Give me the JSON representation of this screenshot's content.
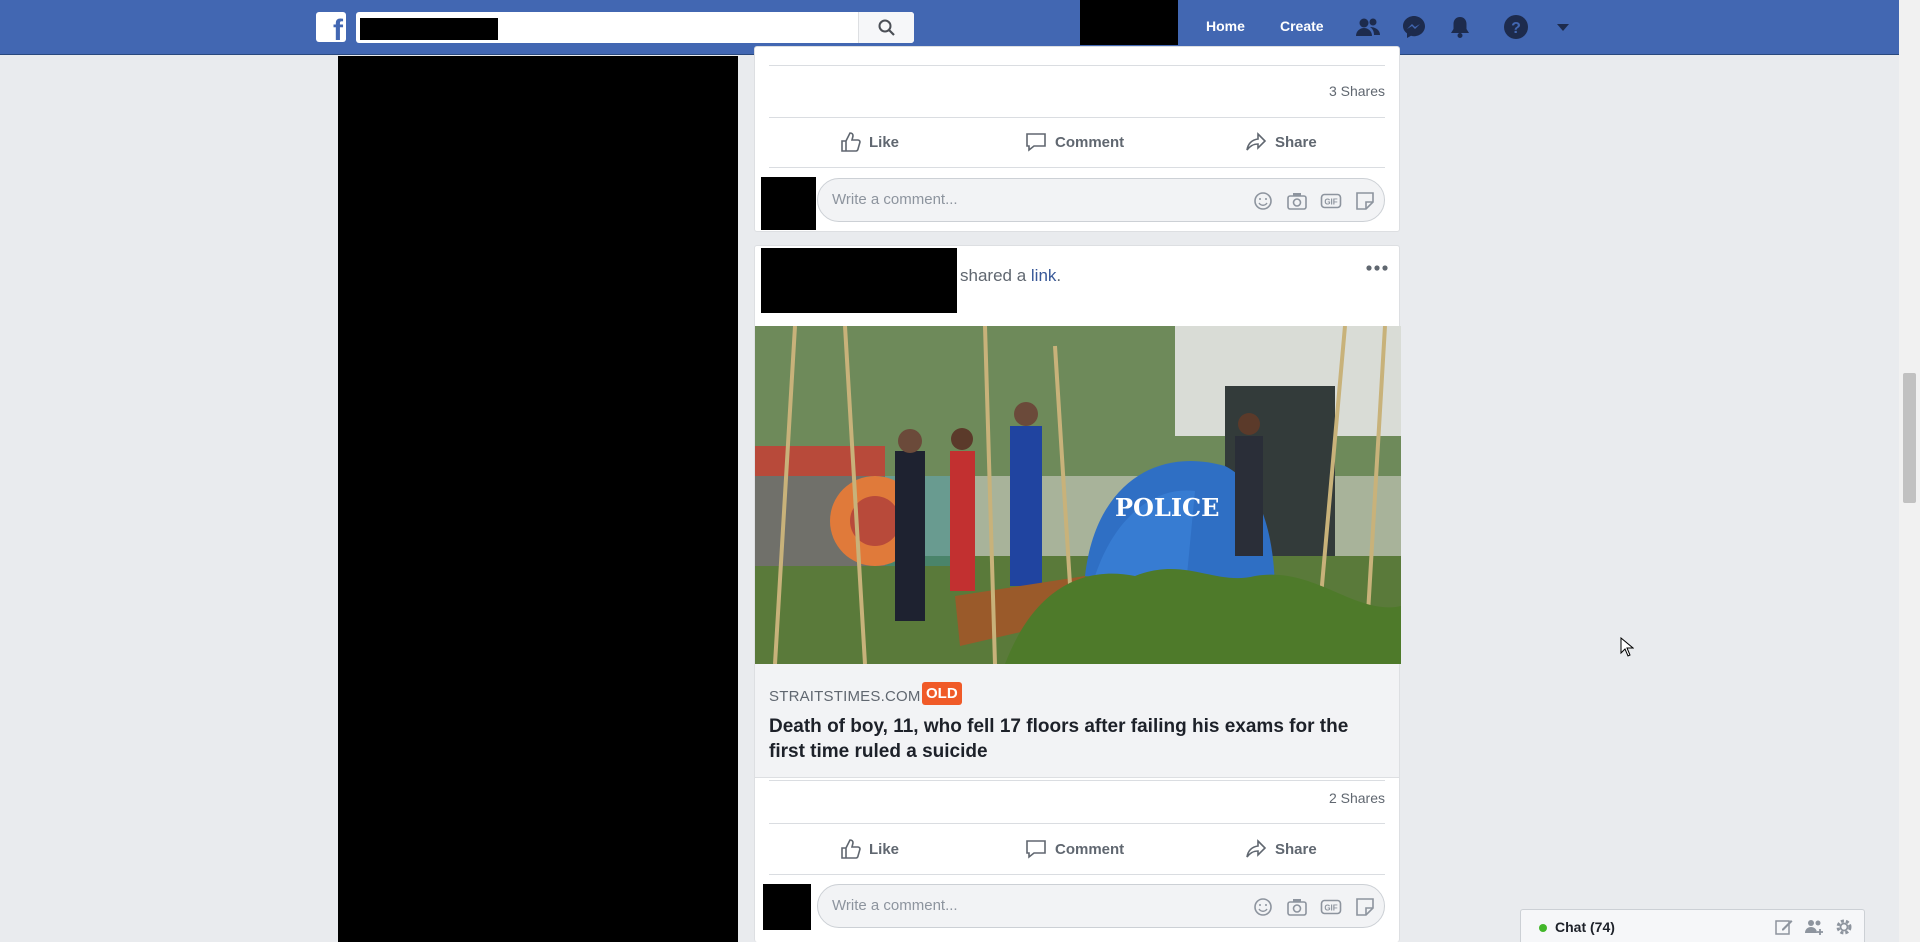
{
  "topbar": {
    "logo": "f",
    "nav": {
      "home": "Home",
      "create": "Create"
    },
    "icons": [
      "facebook-logo-icon",
      "search-icon",
      "friend-requests-icon",
      "messenger-icon",
      "notifications-bell-icon",
      "help-icon",
      "account-menu-caret-icon"
    ]
  },
  "post1": {
    "shares": "3 Shares",
    "actions": {
      "like": "Like",
      "comment": "Comment",
      "share": "Share"
    },
    "comment_placeholder": "Write a comment..."
  },
  "post2": {
    "meta_prefix": "shared a ",
    "meta_link": "link",
    "meta_suffix": ".",
    "image_text": "POLICE",
    "domain": "STRAITSTIMES.COM",
    "badge": "OLD",
    "headline": "Death of boy, 11, who fell 17 floors after failing his exams for the first time ruled a suicide",
    "shares": "2 Shares",
    "actions": {
      "like": "Like",
      "comment": "Comment",
      "share": "Share"
    },
    "comment_placeholder": "Write a comment..."
  },
  "chat": {
    "label": "Chat (74)"
  },
  "colors": {
    "brand": "#4267b2",
    "badge": "#f05a28",
    "online": "#42b72a"
  }
}
